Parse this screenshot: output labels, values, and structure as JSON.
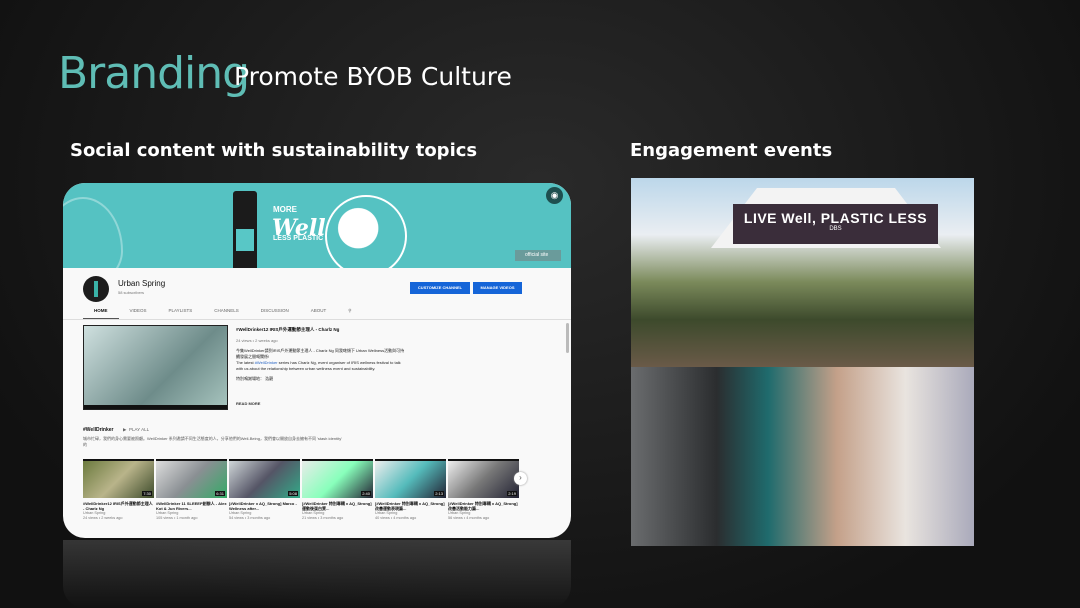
{
  "slide": {
    "title": "Branding",
    "subtitle": "Promote BYOB Culture",
    "left_heading": "Social content with sustainability topics",
    "right_heading": "Engagement events",
    "accent": "#5fbdb5"
  },
  "youtube": {
    "banner": {
      "more": "MORE",
      "well": "Well",
      "less_plastic": "LESS PLASTIC",
      "camera_icon": "camera-icon",
      "official_site": "official site"
    },
    "channel_name": "Urban Spring",
    "subscribers": "58 subscribers",
    "buttons": {
      "customize": "CUSTOMIZE CHANNEL",
      "manage": "MANAGE VIDEOS"
    },
    "tabs": [
      "HOME",
      "VIDEOS",
      "PLAYLISTS",
      "CHANNELS",
      "DISCUSSION",
      "ABOUT"
    ],
    "featured": {
      "title": "#WellDrinker12 IRIS戶外運動節主理人 - Charlz Ng",
      "meta": "24 views • 2 weeks ago",
      "desc1": "今集WellDrinker請到IRIS戶外運動節主理人 - Charlz Ng 同我哋傾下 Urban Wellness活動與可持續發展之間嘅關係!",
      "desc2a": "The latest ",
      "desc2_tag": "#WellDrinker",
      "desc2b": " series has Charlz Ng, event organiser of IRIS wellness festival to talk with us about the relationship between urban wellness event and sustainability.",
      "desc3": "特別鳴謝場地： 浩觀",
      "read_more": "READ MORE"
    },
    "playlist": {
      "name": "#WellDrinker",
      "play_all": "PLAY ALL",
      "desc": "城市忙碌，我們的身心需要被照顧。WellDrinker 系列邀請不同生活態度的人，分享他們的Well-Being，我們會以開放自身去擁有不同 'stash identity' 的"
    },
    "videos": [
      {
        "title": "#WellDrinker12 IRIS戶外運動節主理人 - Charlz Ng",
        "channel": "Urban Spring",
        "views": "24 views • 2 weeks ago",
        "duration": "7:30"
      },
      {
        "title": "#WellDrinker 11 SLEEEP創辦人 - Alex Kot & Jun Rivers...",
        "channel": "Urban Spring",
        "views": "105 views • 1 month ago",
        "duration": "6:31"
      },
      {
        "title": "[#WellDrinker x AQ_Strong] Marco - Wellness after...",
        "channel": "Urban Spring",
        "views": "54 views • 3 months ago",
        "duration": "5:08"
      },
      {
        "title": "[#WellDrinker 特別專輯 x AQ_Strong] 運動後蛋白質...",
        "channel": "Urban Spring",
        "views": "21 views • 3 months ago",
        "duration": "2:40"
      },
      {
        "title": "[#WellDrinker 特別專輯 x AQ_Strong] 改善運動表現篇...",
        "channel": "Urban Spring",
        "views": "40 views • 4 months ago",
        "duration": "2:13"
      },
      {
        "title": "[#WellDrinker 特別專輯 x AQ_Strong] 改善活動能力篇...",
        "channel": "Urban Spring",
        "views": "56 views • 4 months ago",
        "duration": "2:19"
      }
    ]
  },
  "event_photo": {
    "sign": "LIVE Well, PLASTIC LESS",
    "sponsor": "DBS"
  }
}
